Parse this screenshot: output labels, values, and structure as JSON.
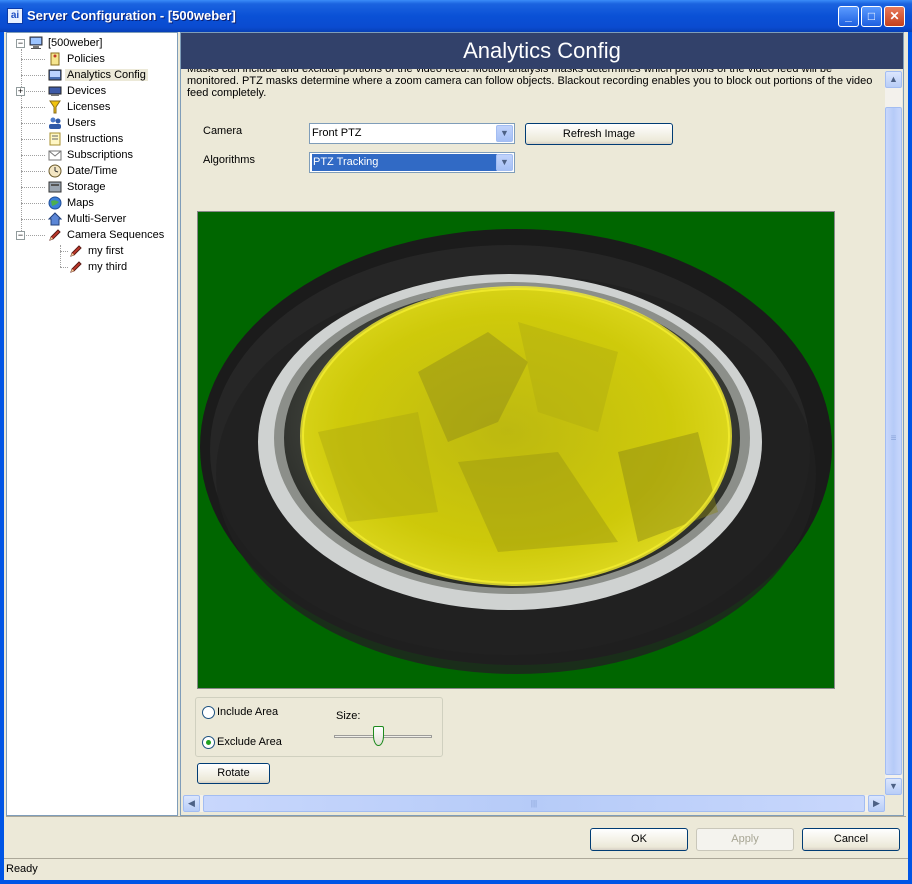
{
  "window": {
    "title": "Server Configuration - [500weber]",
    "app_icon_text": "ai",
    "minimize": "_",
    "maximize": "□",
    "close": "✕"
  },
  "tree": {
    "root": "[500weber]",
    "items": [
      {
        "label": "Policies",
        "icon": "policy-icon"
      },
      {
        "label": "Analytics Config",
        "icon": "analytics-icon",
        "selected": true
      },
      {
        "label": "Devices",
        "icon": "devices-icon",
        "expandable": true
      },
      {
        "label": "Licenses",
        "icon": "licenses-icon"
      },
      {
        "label": "Users",
        "icon": "users-icon"
      },
      {
        "label": "Instructions",
        "icon": "instructions-icon"
      },
      {
        "label": "Subscriptions",
        "icon": "subscriptions-icon"
      },
      {
        "label": "Date/Time",
        "icon": "clock-icon"
      },
      {
        "label": "Storage",
        "icon": "storage-icon"
      },
      {
        "label": "Maps",
        "icon": "globe-icon"
      },
      {
        "label": "Multi-Server",
        "icon": "house-icon"
      },
      {
        "label": "Camera Sequences",
        "icon": "pencil-icon",
        "expanded": true
      }
    ],
    "sequences": [
      "my first",
      "my third"
    ]
  },
  "page": {
    "header": "Analytics Config",
    "description": "Masks can include and exclude portions of the video feed.  Motion analysis masks determines which portions of the video feed will be monitored.  PTZ masks determine where a zoom camera can follow objects.  Blackout recording enables you to block out portions of the video feed completely.",
    "camera_label": "Camera",
    "camera_value": "Front PTZ",
    "algorithms_label": "Algorithms",
    "algorithms_value": "PTZ Tracking",
    "refresh_button": "Refresh Image",
    "include_area": "Include Area",
    "exclude_area": "Exclude Area",
    "selected_area": "exclude",
    "size_label": "Size:",
    "size_level": 0.45,
    "rotate_button": "Rotate",
    "hscroll_grip": "|||",
    "vscroll_grip": "≡"
  },
  "footer": {
    "ok": "OK",
    "apply": "Apply",
    "cancel": "Cancel",
    "status": "Ready"
  },
  "colors": {
    "header_bg": "#32416a",
    "mask_yellow": "#e6e000",
    "video_bg": "#006600"
  }
}
